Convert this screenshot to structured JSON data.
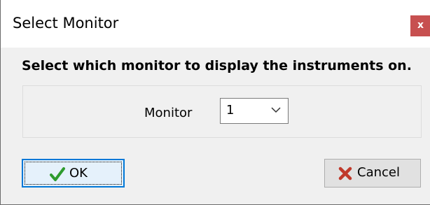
{
  "window": {
    "title": "Select Monitor",
    "close_label": "x"
  },
  "content": {
    "heading": "Select which monitor to display the instruments on."
  },
  "monitor_field": {
    "label": "Monitor",
    "selected_value": "1"
  },
  "buttons": {
    "ok_label": "OK",
    "cancel_label": "Cancel"
  },
  "colors": {
    "close_button": "#c75050",
    "focus_border": "#0078d7",
    "ok_check": "#2e9b2e",
    "cancel_x": "#c0392b"
  },
  "icons": {
    "ok": "checkmark-icon",
    "cancel": "x-icon",
    "dropdown": "chevron-down-icon"
  }
}
